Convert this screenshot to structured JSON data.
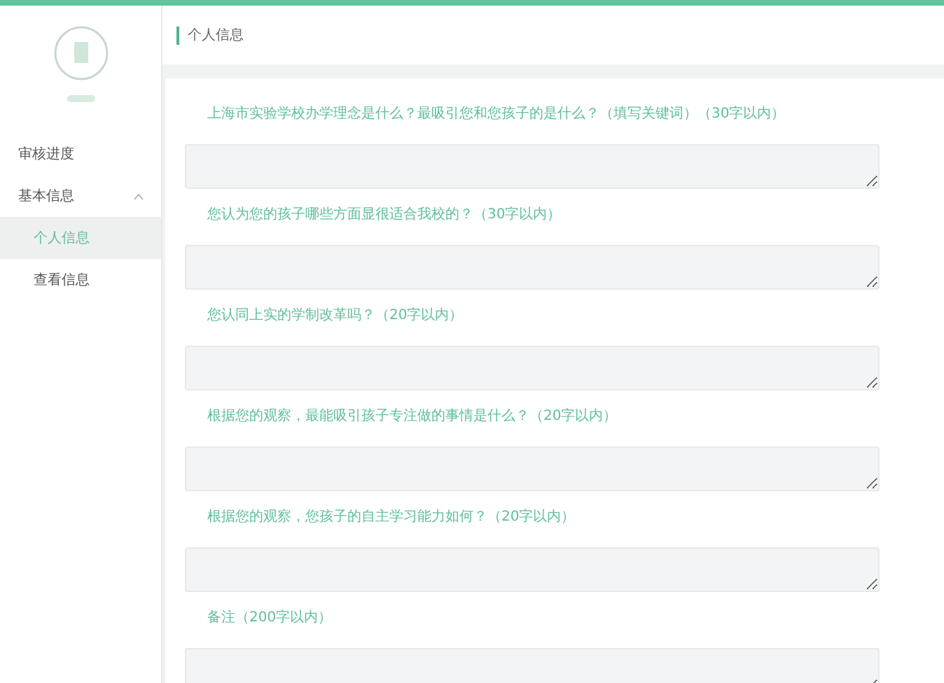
{
  "sidebar": {
    "items": [
      {
        "label": "审核进度",
        "selected": false
      },
      {
        "label": "基本信息",
        "selected": false,
        "expanded": true,
        "children": [
          {
            "label": "个人信息",
            "selected": true
          },
          {
            "label": "查看信息",
            "selected": false
          }
        ]
      }
    ]
  },
  "page": {
    "title": "个人信息"
  },
  "questions": [
    {
      "label": "上海市实验学校办学理念是什么？最吸引您和您孩子的是什么？（填写关键词）（30字以内）"
    },
    {
      "label": "您认为您的孩子哪些方面显很适合我校的？（30字以内）"
    },
    {
      "label": "您认同上实的学制改革吗？（20字以内）"
    },
    {
      "label": "根据您的观察，最能吸引孩子专注做的事情是什么？（20字以内）"
    },
    {
      "label": "根据您的观察，您孩子的自主学习能力如何？（20字以内）"
    },
    {
      "label": "备注（200字以内）"
    }
  ]
}
